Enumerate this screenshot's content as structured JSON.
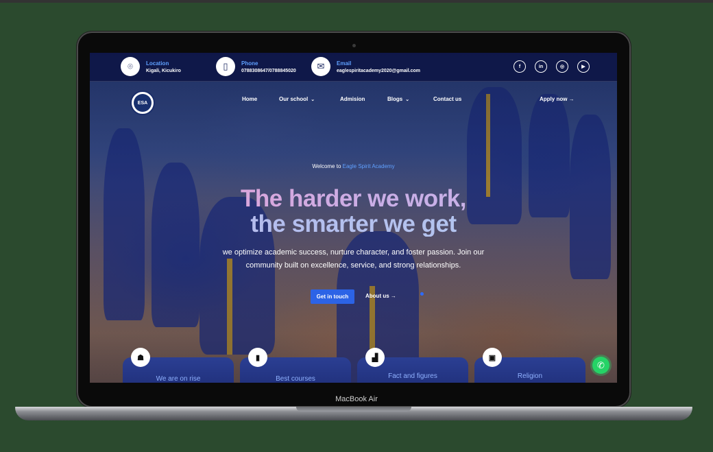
{
  "device": {
    "label": "MacBook Air"
  },
  "topbar": {
    "location": {
      "label": "Location",
      "value": "Kigali, Kicukiro",
      "icon": "location-pin-icon"
    },
    "phone": {
      "label": "Phone",
      "value": "0788308647/0788845020",
      "icon": "phone-icon"
    },
    "email": {
      "label": "Email",
      "value": "eaglespiritacademy2020@gmail.com",
      "icon": "mail-icon"
    },
    "social": [
      {
        "name": "facebook-icon",
        "glyph": "f"
      },
      {
        "name": "linkedin-icon",
        "glyph": "in"
      },
      {
        "name": "instagram-icon",
        "glyph": "◎"
      },
      {
        "name": "youtube-icon",
        "glyph": "▶"
      }
    ]
  },
  "nav": {
    "logo_text": "ESA",
    "items": [
      {
        "label": "Home"
      },
      {
        "label": "Our school",
        "dropdown": true
      },
      {
        "label": "Admision"
      },
      {
        "label": "Blogs",
        "dropdown": true
      },
      {
        "label": "Contact us"
      }
    ],
    "cta": "Apply now →"
  },
  "hero": {
    "welcome_prefix": "Welcome to",
    "welcome_name": "Eagle Spirit Academy",
    "headline_line1": "The harder we work,",
    "headline_line2": "the smarter we get",
    "subtitle": "we optimize academic success, nurture character, and foster passion. Join our community built on excellence, service, and strong relationships.",
    "primary_button": "Get in touch",
    "secondary_link": "About us →"
  },
  "cards": [
    {
      "title": "We are on rise",
      "icon": "graduate-icon"
    },
    {
      "title": "Best courses",
      "icon": "bookmark-icon"
    },
    {
      "title": "Fact and figures",
      "icon": "bar-chart-icon"
    },
    {
      "title": "Religion",
      "icon": "bible-icon"
    }
  ],
  "colors": {
    "accent": "#2c63e6",
    "link": "#5fa0ff",
    "topbar": "#0e1646",
    "background": "#2b4a2e"
  }
}
